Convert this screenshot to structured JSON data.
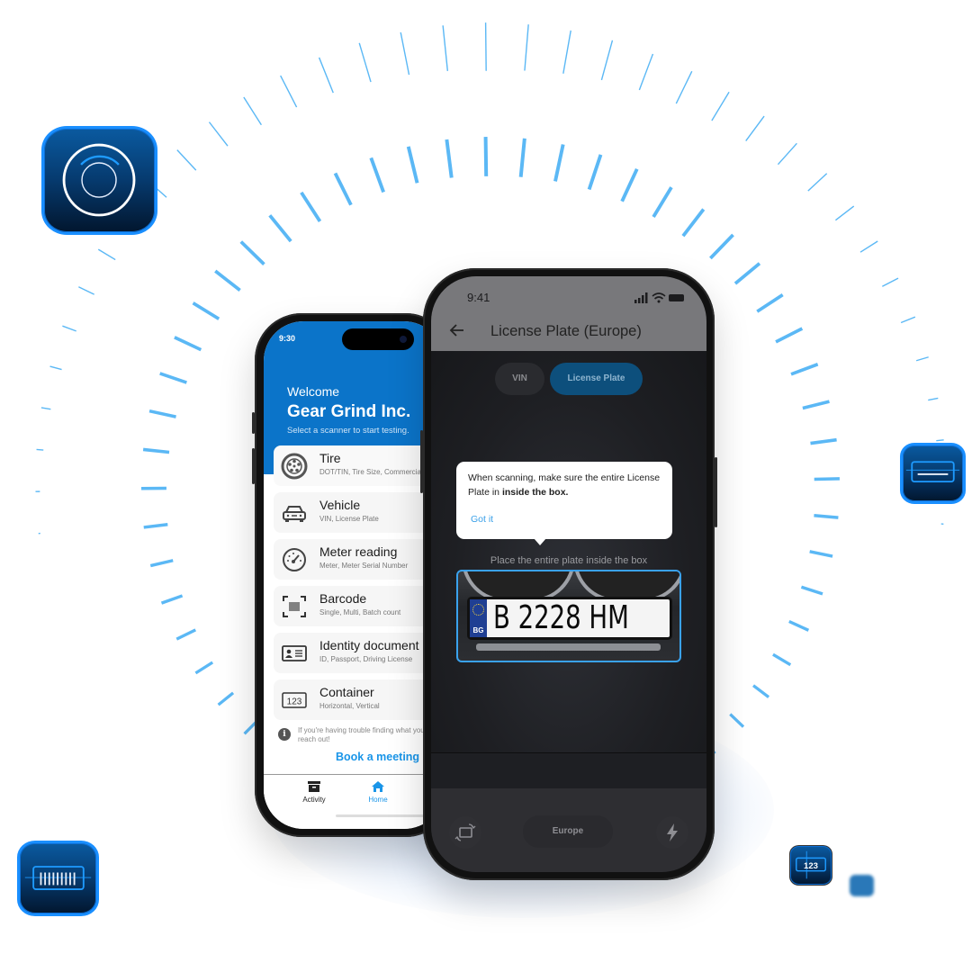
{
  "colors": {
    "ray": "#5bb8f5",
    "brand_blue": "#0b74c9",
    "accent_blue": "#1a95e8",
    "icon_border": "#1a8fff"
  },
  "decor_icons": [
    {
      "name": "camera-scanner-icon"
    },
    {
      "name": "vin-scanner-icon"
    },
    {
      "name": "barcode-scanner-icon"
    },
    {
      "name": "meter-123-scanner-icon"
    }
  ],
  "home_app": {
    "status_time": "9:30",
    "welcome": "Welcome",
    "company": "Gear Grind Inc.",
    "subtitle": "Select a scanner to start testing.",
    "scanners": [
      {
        "icon": "tire-icon",
        "title": "Tire",
        "subtitle": "DOT/TIN, Tire Size, Commercial"
      },
      {
        "icon": "car-icon",
        "title": "Vehicle",
        "subtitle": "VIN, License Plate"
      },
      {
        "icon": "gauge-icon",
        "title": "Meter reading",
        "subtitle": "Meter, Meter Serial Number"
      },
      {
        "icon": "barcode-icon",
        "title": "Barcode",
        "subtitle": "Single, Multi, Batch count"
      },
      {
        "icon": "id-card-icon",
        "title": "Identity document",
        "subtitle": "ID, Passport, Driving License"
      },
      {
        "icon": "container-123-icon",
        "title": "Container",
        "subtitle": "Horizontal, Vertical"
      }
    ],
    "help_text": "If you're having trouble finding what you need, reach out!",
    "book_meeting": "Book a meeting",
    "tabs": [
      {
        "label": "Activity",
        "icon": "archive-box-icon",
        "active": false
      },
      {
        "label": "Home",
        "icon": "home-icon",
        "active": true
      }
    ]
  },
  "scanner_app": {
    "status_time": "9:41",
    "title": "License Plate (Europe)",
    "segments": [
      {
        "label": "VIN",
        "active": false
      },
      {
        "label": "License Plate",
        "active": true
      }
    ],
    "tooltip": {
      "text_prefix": "When scanning, make sure the entire License Plate in ",
      "text_bold": "inside the box.",
      "action": "Got it"
    },
    "hint": "Place the entire plate inside the box",
    "plate": {
      "country_code": "BG",
      "number": "B 2228 HM"
    },
    "region_button": "Europe"
  }
}
